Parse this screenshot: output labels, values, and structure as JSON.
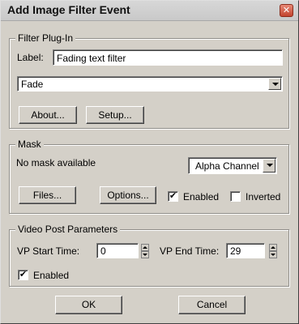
{
  "window": {
    "title": "Add Image Filter Event",
    "close_glyph": "✕"
  },
  "filter_plugin": {
    "group_title": "Filter Plug-In",
    "label_caption": "Label:",
    "label_value": "Fading text filter",
    "filter_selected": "Fade",
    "about_label": "About...",
    "setup_label": "Setup..."
  },
  "mask": {
    "group_title": "Mask",
    "status_text": "No mask available",
    "channel_selected": "Alpha Channel",
    "files_label": "Files...",
    "options_label": "Options...",
    "enabled_label": "Enabled",
    "enabled_checked": true,
    "inverted_label": "Inverted",
    "inverted_checked": false
  },
  "video_post": {
    "group_title": "Video Post Parameters",
    "start_caption": "VP Start Time:",
    "start_value": "0",
    "end_caption": "VP End Time:",
    "end_value": "29",
    "enabled_label": "Enabled",
    "enabled_checked": true
  },
  "buttons": {
    "ok_label": "OK",
    "cancel_label": "Cancel"
  },
  "glyphs": {
    "check": "✔"
  }
}
